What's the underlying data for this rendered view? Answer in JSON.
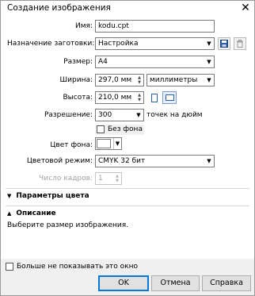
{
  "window": {
    "title": "Создание изображения",
    "close_symbol": "✕"
  },
  "form": {
    "name_label": "Имя:",
    "name_value": "kodu.cpt",
    "preset_label": "Назначение заготовки:",
    "preset_value": "Настройка",
    "size_label": "Размер:",
    "size_value": "A4",
    "width_label": "Ширина:",
    "width_value": "297,0 мм",
    "units_value": "миллиметры",
    "height_label": "Высота:",
    "height_value": "210,0 мм",
    "resolution_label": "Разрешение:",
    "resolution_value": "300",
    "resolution_unit": "точек на дюйм",
    "no_background_label": "Без фона",
    "no_background_checked": false,
    "bg_color_label": "Цвет фона:",
    "bg_color": "#ffffff",
    "color_mode_label": "Цветовой режим:",
    "color_mode_value": "CMYK 32 бит",
    "frames_label": "Число кадров:",
    "frames_value": "1"
  },
  "sections": {
    "color_params": "Параметры цвета",
    "description": "Описание",
    "description_text": "Выберите размер изображения."
  },
  "footer": {
    "dont_show_label": "Больше не показывать это окно",
    "dont_show_checked": false,
    "ok_label": "OK",
    "cancel_label": "Отмена",
    "help_label": "Справка"
  },
  "icons": {
    "save_preset": "save-icon",
    "delete_preset": "trash-icon",
    "portrait": "portrait-page-icon",
    "landscape": "landscape-page-icon"
  },
  "colors": {
    "accent": "#0078d7",
    "footer_bg": "#f0f0f0",
    "section_bg": "#ffffff"
  }
}
